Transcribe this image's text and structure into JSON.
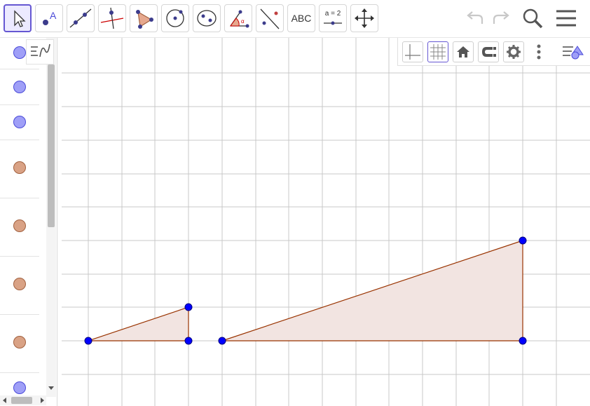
{
  "toolbar": {
    "tools": [
      {
        "name": "move-tool",
        "icon": "arrow-pointer-icon"
      },
      {
        "name": "point-tool",
        "icon": "point-icon"
      },
      {
        "name": "line-tool",
        "icon": "line-icon"
      },
      {
        "name": "perpendicular-line-tool",
        "icon": "perpendicular-icon"
      },
      {
        "name": "polygon-tool",
        "icon": "polygon-icon"
      },
      {
        "name": "circle-center-point-tool",
        "icon": "circle-icon"
      },
      {
        "name": "ellipse-tool",
        "icon": "ellipse-icon"
      },
      {
        "name": "angle-tool",
        "icon": "angle-icon"
      },
      {
        "name": "reflect-tool",
        "icon": "reflect-icon"
      },
      {
        "name": "text-tool",
        "label": "ABC"
      },
      {
        "name": "slider-tool",
        "label": "a = 2"
      },
      {
        "name": "move-graphics-view-tool",
        "icon": "move-arrows-icon"
      }
    ],
    "right": [
      "undo-icon",
      "redo-icon",
      "search-icon",
      "menu-icon"
    ]
  },
  "algebra": {
    "items": [
      {
        "color": "blue"
      },
      {
        "color": "blue"
      },
      {
        "color": "blue"
      },
      {
        "color": "brown"
      },
      {
        "color": "brown"
      },
      {
        "color": "brown"
      },
      {
        "color": "brown"
      },
      {
        "color": "blue"
      }
    ]
  },
  "stylebar": {
    "buttons": [
      "axes-toggle-icon",
      "grid-toggle-icon",
      "home-icon",
      "point-capturing-icon",
      "settings-icon",
      "more-vertical-icon",
      "view-style-icon"
    ]
  },
  "colors": {
    "accent": "#6557d2",
    "point": "#0000ff",
    "polygon_stroke": "#993300",
    "polygon_fill": "#f2e4e1",
    "grid": "#c8c8c8"
  }
}
